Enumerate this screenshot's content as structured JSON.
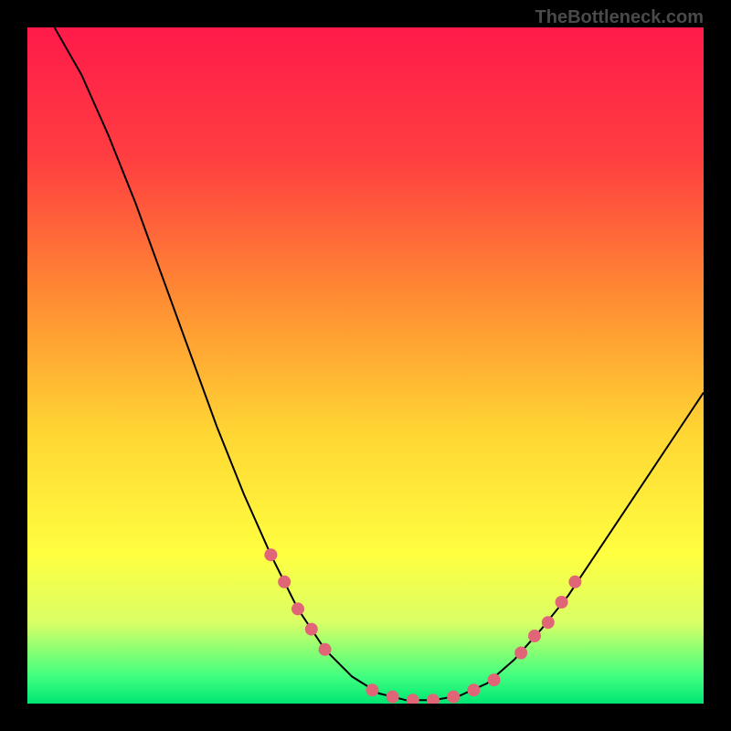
{
  "watermark": "TheBottleneck.com",
  "chart_data": {
    "type": "line",
    "title": "",
    "xlabel": "",
    "ylabel": "",
    "xlim": [
      0,
      100
    ],
    "ylim": [
      0,
      100
    ],
    "gradient_stops": [
      {
        "offset": 0,
        "color": "#ff1a4a"
      },
      {
        "offset": 20,
        "color": "#ff4040"
      },
      {
        "offset": 40,
        "color": "#ff8c33"
      },
      {
        "offset": 60,
        "color": "#ffd633"
      },
      {
        "offset": 78,
        "color": "#ffff40"
      },
      {
        "offset": 88,
        "color": "#d9ff66"
      },
      {
        "offset": 96,
        "color": "#40ff80"
      },
      {
        "offset": 100,
        "color": "#00e673"
      }
    ],
    "curve": [
      {
        "x": 4,
        "y": 100
      },
      {
        "x": 8,
        "y": 93
      },
      {
        "x": 12,
        "y": 84
      },
      {
        "x": 16,
        "y": 74
      },
      {
        "x": 20,
        "y": 63
      },
      {
        "x": 24,
        "y": 52
      },
      {
        "x": 28,
        "y": 41
      },
      {
        "x": 32,
        "y": 31
      },
      {
        "x": 36,
        "y": 22
      },
      {
        "x": 40,
        "y": 14
      },
      {
        "x": 44,
        "y": 8
      },
      {
        "x": 48,
        "y": 4
      },
      {
        "x": 52,
        "y": 1.5
      },
      {
        "x": 56,
        "y": 0.5
      },
      {
        "x": 60,
        "y": 0.5
      },
      {
        "x": 64,
        "y": 1.2
      },
      {
        "x": 68,
        "y": 3
      },
      {
        "x": 72,
        "y": 6.5
      },
      {
        "x": 76,
        "y": 11
      },
      {
        "x": 80,
        "y": 16
      },
      {
        "x": 84,
        "y": 22
      },
      {
        "x": 88,
        "y": 28
      },
      {
        "x": 92,
        "y": 34
      },
      {
        "x": 96,
        "y": 40
      },
      {
        "x": 100,
        "y": 46
      }
    ],
    "markers": [
      {
        "x": 36,
        "y": 22
      },
      {
        "x": 38,
        "y": 18
      },
      {
        "x": 40,
        "y": 14
      },
      {
        "x": 42,
        "y": 11
      },
      {
        "x": 44,
        "y": 8
      },
      {
        "x": 51,
        "y": 2
      },
      {
        "x": 54,
        "y": 1
      },
      {
        "x": 57,
        "y": 0.5
      },
      {
        "x": 60,
        "y": 0.5
      },
      {
        "x": 63,
        "y": 1
      },
      {
        "x": 66,
        "y": 2
      },
      {
        "x": 69,
        "y": 3.5
      },
      {
        "x": 73,
        "y": 7.5
      },
      {
        "x": 75,
        "y": 10
      },
      {
        "x": 77,
        "y": 12
      },
      {
        "x": 79,
        "y": 15
      },
      {
        "x": 81,
        "y": 18
      }
    ],
    "marker_color": "#e06677",
    "curve_color": "#000000"
  }
}
